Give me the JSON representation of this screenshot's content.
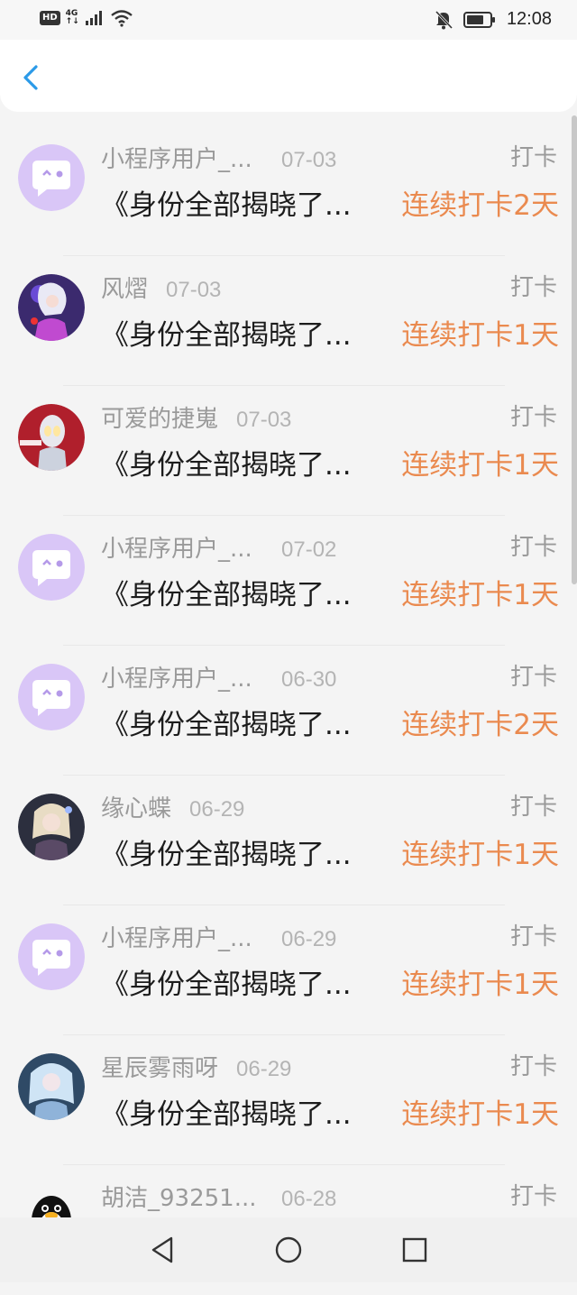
{
  "status_bar": {
    "hd": "HD",
    "network_top": "4G",
    "network_bottom": "↑↓",
    "time": "12:08",
    "icons": [
      "hd-icon",
      "signal-icon",
      "wifi-icon",
      "bell-off-icon",
      "battery-icon"
    ]
  },
  "header": {
    "back_icon": "chevron-left-icon",
    "accent": "#2b9ae8"
  },
  "colors": {
    "streak": "#ea8a4f",
    "muted": "#9a9a9a",
    "date": "#b4b4b4"
  },
  "rows": [
    {
      "name": "小程序用户_...",
      "date": "07-03",
      "tag": "打卡",
      "title": "《身份全部揭晓了...",
      "streak": "连续打卡2天",
      "avatar": "chat-bubble-avatar"
    },
    {
      "name": "风熠",
      "date": "07-03",
      "tag": "打卡",
      "title": "《身份全部揭晓了...",
      "streak": "连续打卡1天",
      "avatar": "anime-avatar"
    },
    {
      "name": "可爱的捷嵬",
      "date": "07-03",
      "tag": "打卡",
      "title": "《身份全部揭晓了...",
      "streak": "连续打卡1天",
      "avatar": "ultraman-avatar"
    },
    {
      "name": "小程序用户_...",
      "date": "07-02",
      "tag": "打卡",
      "title": "《身份全部揭晓了...",
      "streak": "连续打卡1天",
      "avatar": "chat-bubble-avatar"
    },
    {
      "name": "小程序用户_...",
      "date": "06-30",
      "tag": "打卡",
      "title": "《身份全部揭晓了...",
      "streak": "连续打卡2天",
      "avatar": "chat-bubble-avatar"
    },
    {
      "name": "缘心蝶",
      "date": "06-29",
      "tag": "打卡",
      "title": "《身份全部揭晓了...",
      "streak": "连续打卡1天",
      "avatar": "anime-avatar"
    },
    {
      "name": "小程序用户_...",
      "date": "06-29",
      "tag": "打卡",
      "title": "《身份全部揭晓了...",
      "streak": "连续打卡1天",
      "avatar": "chat-bubble-avatar"
    },
    {
      "name": "星辰雾雨呀",
      "date": "06-29",
      "tag": "打卡",
      "title": "《身份全部揭晓了...",
      "streak": "连续打卡1天",
      "avatar": "anime-avatar"
    },
    {
      "name": "胡洁_93251...",
      "date": "06-28",
      "tag": "打卡",
      "title": "",
      "streak": "",
      "avatar": "penguin-avatar"
    }
  ],
  "nav": [
    "back-triangle-icon",
    "home-circle-icon",
    "recent-square-icon"
  ]
}
